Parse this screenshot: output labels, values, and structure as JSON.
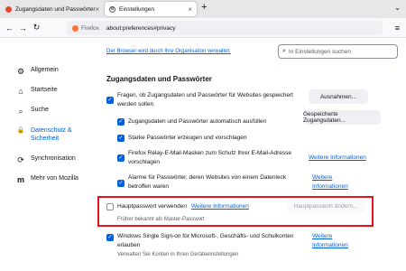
{
  "tabs": [
    {
      "title": "Zugangsdaten und Passwörter"
    },
    {
      "title": "Einstellungen"
    }
  ],
  "newtab_symbol": "+",
  "nav": {
    "brand": "Firefox",
    "url": "about:preferences#privacy"
  },
  "org_message": "Der Browser wird durch Ihre Organisation verwaltet.",
  "search_placeholder": "In Einstellungen suchen",
  "sidebar": {
    "items": [
      {
        "label": "Allgemein",
        "icon": "gear-icon",
        "glyph": "⚙"
      },
      {
        "label": "Startseite",
        "icon": "home-icon",
        "glyph": "⌂"
      },
      {
        "label": "Suche",
        "icon": "search-icon",
        "glyph": "⌕"
      },
      {
        "label": "Datenschutz & Sicherheit",
        "icon": "lock-icon",
        "glyph": "🔒"
      },
      {
        "label": "Synchronisation",
        "icon": "sync-icon",
        "glyph": "⟳"
      },
      {
        "label": "Mehr von Mozilla",
        "icon": "mozilla-icon",
        "glyph": "m"
      }
    ]
  },
  "section": {
    "title": "Zugangsdaten und Passwörter",
    "ask_save": "Fragen, ob Zugangsdaten und Passwörter für Websites gespeichert werden sollen",
    "autofill": "Zugangsdaten und Passwörter automatisch ausfüllen",
    "strong_pw": "Starke Passwörter erzeugen und vorschlagen",
    "relay": "Firefox Relay-E-Mail-Masken zum Schutz Ihrer E-Mail-Adresse vorschlagen",
    "breach": "Alarme für Passwörter, deren Websites von einem Datenleck betroffen waren",
    "primary_pw": "Hauptpasswort verwenden",
    "primary_pw_note": "Früher bekannt als Master-Passwort",
    "sso": "Windows Single Sign-on für Microsoft-, Geschäfts- und Schulkonten erlauben",
    "sso_note": "Verwalten Sie Konten in Ihren Geräteeinstellungen"
  },
  "buttons": {
    "exceptions": "Ausnahmen...",
    "saved_logins": "Gespeicherte Zugangsdaten...",
    "change_primary": "Hauptpasswort ändern..."
  },
  "links": {
    "more_info": "Weitere Informationen"
  },
  "highlight_color": "#e2141e",
  "accent_color": "#0061e0"
}
